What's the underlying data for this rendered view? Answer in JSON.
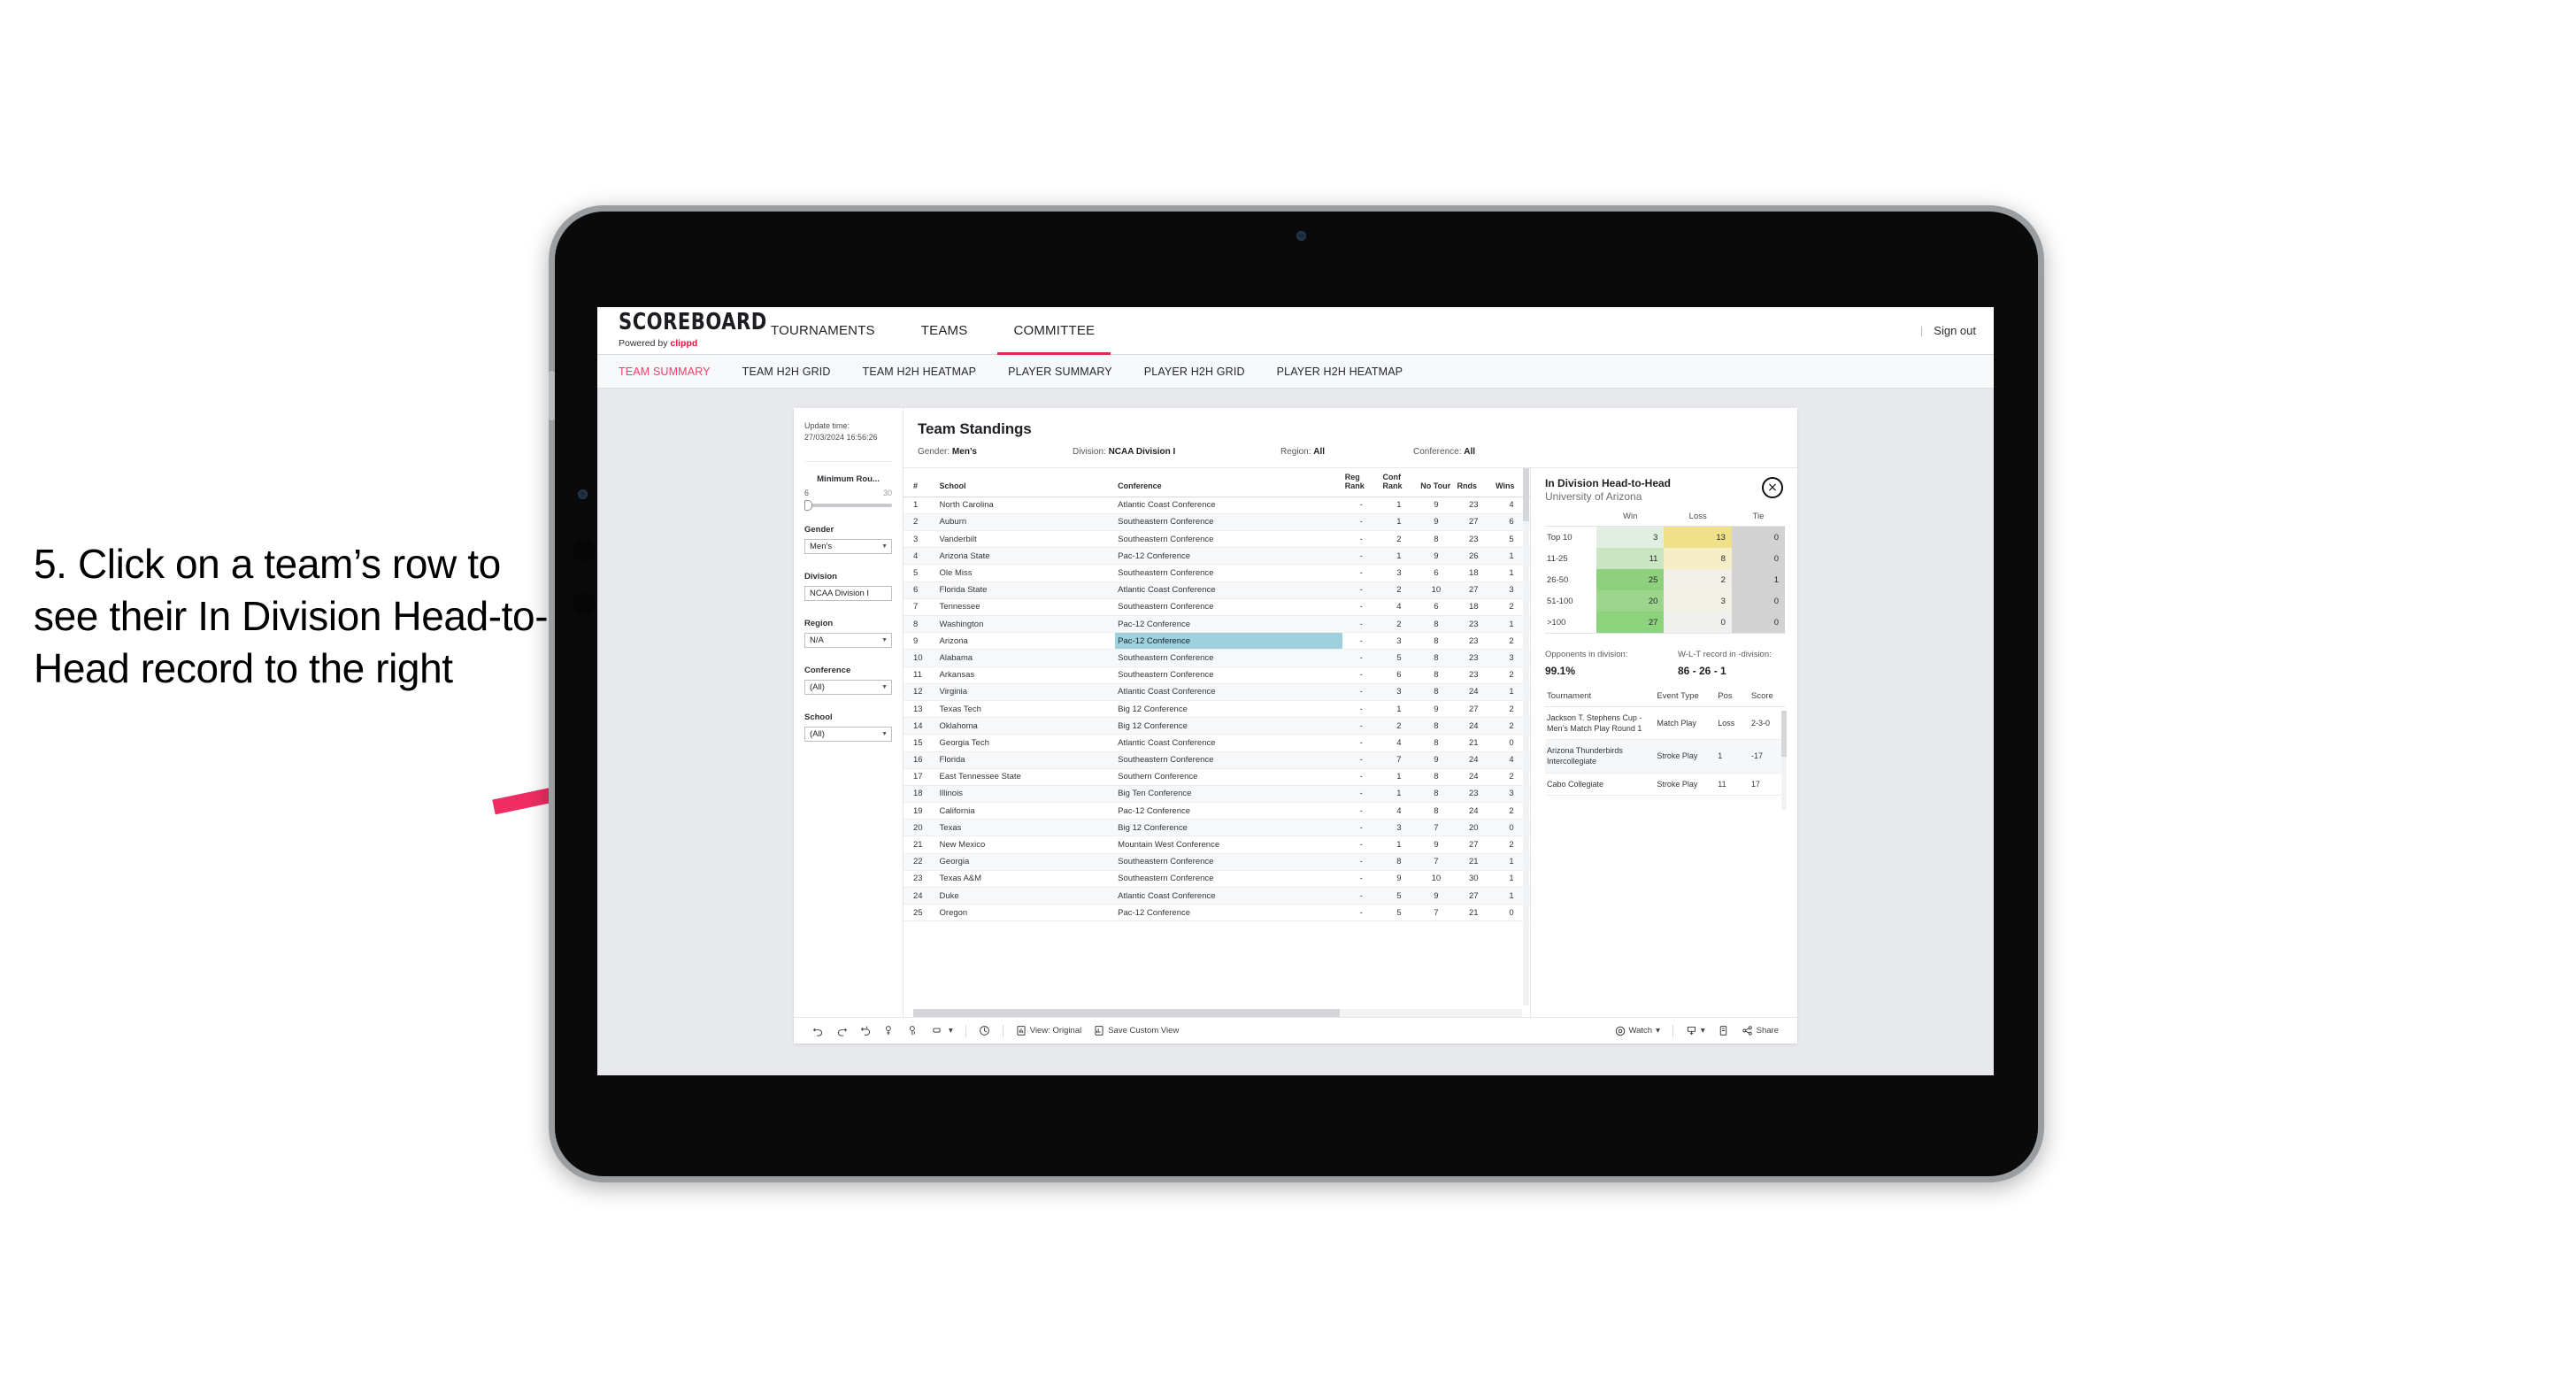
{
  "instruction": "5. Click on a team’s row to see their In Division Head-to-Head record to the right",
  "colors": {
    "accent": "#e8123c",
    "arrow": "#ef2d63",
    "highlight": "#9ed0dd",
    "tab_active": "#e8436b"
  },
  "app": {
    "brand": {
      "title": "SCOREBOARD",
      "powered_prefix": "Powered by ",
      "powered_name": "clippd"
    },
    "main_nav": [
      {
        "label": "TOURNAMENTS",
        "active": false
      },
      {
        "label": "TEAMS",
        "active": false
      },
      {
        "label": "COMMITTEE",
        "active": true
      }
    ],
    "sign_out": {
      "divider": "|",
      "label": "Sign out"
    },
    "sub_nav": [
      {
        "label": "TEAM SUMMARY",
        "active": true
      },
      {
        "label": "TEAM H2H GRID",
        "active": false
      },
      {
        "label": "TEAM H2H HEATMAP",
        "active": false
      },
      {
        "label": "PLAYER SUMMARY",
        "active": false
      },
      {
        "label": "PLAYER H2H GRID",
        "active": false
      },
      {
        "label": "PLAYER H2H HEATMAP",
        "active": false
      }
    ]
  },
  "filters": {
    "update_time_label": "Update time:",
    "update_time_value": "27/03/2024 16:56:26",
    "minimum_rounds": {
      "label": "Minimum Rou...",
      "min": "6",
      "max": "30"
    },
    "gender": {
      "label": "Gender",
      "value": "Men’s"
    },
    "division": {
      "label": "Division",
      "value": "NCAA Division I"
    },
    "region": {
      "label": "Region",
      "value": "N/A"
    },
    "conference": {
      "label": "Conference",
      "value": "(All)"
    },
    "school": {
      "label": "School",
      "value": "(All)"
    }
  },
  "standings": {
    "title": "Team Standings",
    "meta": {
      "gender_label": "Gender:",
      "gender_value": "Men’s",
      "division_label": "Division:",
      "division_value": "NCAA Division I",
      "region_label": "Region:",
      "region_value": "All",
      "conference_label": "Conference:",
      "conference_value": "All"
    },
    "columns": [
      "#",
      "School",
      "Conference",
      "Reg Rank",
      "Conf Rank",
      "No Tour",
      "Rnds",
      "Wins"
    ],
    "rows": [
      {
        "rank": "1",
        "school": "North Carolina",
        "conf": "Atlantic Coast Conference",
        "reg": "-",
        "cr": "1",
        "nt": "9",
        "rnds": "23",
        "wins": "4",
        "selected": false
      },
      {
        "rank": "2",
        "school": "Auburn",
        "conf": "Southeastern Conference",
        "reg": "-",
        "cr": "1",
        "nt": "9",
        "rnds": "27",
        "wins": "6",
        "selected": false
      },
      {
        "rank": "3",
        "school": "Vanderbilt",
        "conf": "Southeastern Conference",
        "reg": "-",
        "cr": "2",
        "nt": "8",
        "rnds": "23",
        "wins": "5",
        "selected": false
      },
      {
        "rank": "4",
        "school": "Arizona State",
        "conf": "Pac-12 Conference",
        "reg": "-",
        "cr": "1",
        "nt": "9",
        "rnds": "26",
        "wins": "1",
        "selected": false
      },
      {
        "rank": "5",
        "school": "Ole Miss",
        "conf": "Southeastern Conference",
        "reg": "-",
        "cr": "3",
        "nt": "6",
        "rnds": "18",
        "wins": "1",
        "selected": false
      },
      {
        "rank": "6",
        "school": "Florida State",
        "conf": "Atlantic Coast Conference",
        "reg": "-",
        "cr": "2",
        "nt": "10",
        "rnds": "27",
        "wins": "3",
        "selected": false
      },
      {
        "rank": "7",
        "school": "Tennessee",
        "conf": "Southeastern Conference",
        "reg": "-",
        "cr": "4",
        "nt": "6",
        "rnds": "18",
        "wins": "2",
        "selected": false
      },
      {
        "rank": "8",
        "school": "Washington",
        "conf": "Pac-12 Conference",
        "reg": "-",
        "cr": "2",
        "nt": "8",
        "rnds": "23",
        "wins": "1",
        "selected": false
      },
      {
        "rank": "9",
        "school": "Arizona",
        "conf": "Pac-12 Conference",
        "reg": "-",
        "cr": "3",
        "nt": "8",
        "rnds": "23",
        "wins": "2",
        "selected": true
      },
      {
        "rank": "10",
        "school": "Alabama",
        "conf": "Southeastern Conference",
        "reg": "-",
        "cr": "5",
        "nt": "8",
        "rnds": "23",
        "wins": "3",
        "selected": false
      },
      {
        "rank": "11",
        "school": "Arkansas",
        "conf": "Southeastern Conference",
        "reg": "-",
        "cr": "6",
        "nt": "8",
        "rnds": "23",
        "wins": "2",
        "selected": false
      },
      {
        "rank": "12",
        "school": "Virginia",
        "conf": "Atlantic Coast Conference",
        "reg": "-",
        "cr": "3",
        "nt": "8",
        "rnds": "24",
        "wins": "1",
        "selected": false
      },
      {
        "rank": "13",
        "school": "Texas Tech",
        "conf": "Big 12 Conference",
        "reg": "-",
        "cr": "1",
        "nt": "9",
        "rnds": "27",
        "wins": "2",
        "selected": false
      },
      {
        "rank": "14",
        "school": "Oklahoma",
        "conf": "Big 12 Conference",
        "reg": "-",
        "cr": "2",
        "nt": "8",
        "rnds": "24",
        "wins": "2",
        "selected": false
      },
      {
        "rank": "15",
        "school": "Georgia Tech",
        "conf": "Atlantic Coast Conference",
        "reg": "-",
        "cr": "4",
        "nt": "8",
        "rnds": "21",
        "wins": "0",
        "selected": false
      },
      {
        "rank": "16",
        "school": "Florida",
        "conf": "Southeastern Conference",
        "reg": "-",
        "cr": "7",
        "nt": "9",
        "rnds": "24",
        "wins": "4",
        "selected": false
      },
      {
        "rank": "17",
        "school": "East Tennessee State",
        "conf": "Southern Conference",
        "reg": "-",
        "cr": "1",
        "nt": "8",
        "rnds": "24",
        "wins": "2",
        "selected": false
      },
      {
        "rank": "18",
        "school": "Illinois",
        "conf": "Big Ten Conference",
        "reg": "-",
        "cr": "1",
        "nt": "8",
        "rnds": "23",
        "wins": "3",
        "selected": false
      },
      {
        "rank": "19",
        "school": "California",
        "conf": "Pac-12 Conference",
        "reg": "-",
        "cr": "4",
        "nt": "8",
        "rnds": "24",
        "wins": "2",
        "selected": false
      },
      {
        "rank": "20",
        "school": "Texas",
        "conf": "Big 12 Conference",
        "reg": "-",
        "cr": "3",
        "nt": "7",
        "rnds": "20",
        "wins": "0",
        "selected": false
      },
      {
        "rank": "21",
        "school": "New Mexico",
        "conf": "Mountain West Conference",
        "reg": "-",
        "cr": "1",
        "nt": "9",
        "rnds": "27",
        "wins": "2",
        "selected": false
      },
      {
        "rank": "22",
        "school": "Georgia",
        "conf": "Southeastern Conference",
        "reg": "-",
        "cr": "8",
        "nt": "7",
        "rnds": "21",
        "wins": "1",
        "selected": false
      },
      {
        "rank": "23",
        "school": "Texas A&M",
        "conf": "Southeastern Conference",
        "reg": "-",
        "cr": "9",
        "nt": "10",
        "rnds": "30",
        "wins": "1",
        "selected": false
      },
      {
        "rank": "24",
        "school": "Duke",
        "conf": "Atlantic Coast Conference",
        "reg": "-",
        "cr": "5",
        "nt": "9",
        "rnds": "27",
        "wins": "1",
        "selected": false
      },
      {
        "rank": "25",
        "school": "Oregon",
        "conf": "Pac-12 Conference",
        "reg": "-",
        "cr": "5",
        "nt": "7",
        "rnds": "21",
        "wins": "0",
        "selected": false
      }
    ]
  },
  "h2h": {
    "title": "In Division Head-to-Head",
    "subtitle": "University of Arizona",
    "close_icon": "×",
    "columns": [
      "",
      "Win",
      "Loss",
      "Tie"
    ],
    "rows": [
      {
        "bucket": "Top 10",
        "win": "3",
        "loss": "13",
        "tie": "0",
        "win_color": "#e2eee1",
        "loss_color": "#f0e08a",
        "tie_color": "#d2d2d2"
      },
      {
        "bucket": "11-25",
        "win": "11",
        "loss": "8",
        "tie": "0",
        "win_color": "#cae5c2",
        "loss_color": "#f4edc6",
        "tie_color": "#d2d2d2"
      },
      {
        "bucket": "26-50",
        "win": "25",
        "loss": "2",
        "tie": "1",
        "win_color": "#8ed07e",
        "loss_color": "#f1efe7",
        "tie_color": "#d2d2d2"
      },
      {
        "bucket": "51-100",
        "win": "20",
        "loss": "3",
        "tie": "0",
        "win_color": "#9bd68c",
        "loss_color": "#f3f0e6",
        "tie_color": "#d2d2d2"
      },
      {
        "bucket": ">100",
        "win": "27",
        "loss": "0",
        "tie": "0",
        "win_color": "#8dd27d",
        "loss_color": "#f0f0ef",
        "tie_color": "#d2d2d2"
      }
    ],
    "stats": [
      {
        "key": "Opponents in division:",
        "value": "99.1%"
      },
      {
        "key": "W-L-T record in -division:",
        "value": "86 - 26 - 1"
      }
    ],
    "tournaments": {
      "columns": [
        "Tournament",
        "Event Type",
        "Pos",
        "Score"
      ],
      "rows": [
        {
          "name": "Jackson T. Stephens Cup - Men’s Match Play Round 1",
          "type": "Match Play",
          "pos": "Loss",
          "score": "2-3-0"
        },
        {
          "name": "Arizona Thunderbirds Intercollegiate",
          "type": "Stroke Play",
          "pos": "1",
          "score": "-17"
        },
        {
          "name": "Cabo Collegiate",
          "type": "Stroke Play",
          "pos": "11",
          "score": "17"
        }
      ]
    }
  },
  "toolbar": {
    "view_label": "View: Original",
    "save_label": "Save Custom View",
    "watch_label": "Watch",
    "share_label": "Share",
    "caret": "▾"
  }
}
